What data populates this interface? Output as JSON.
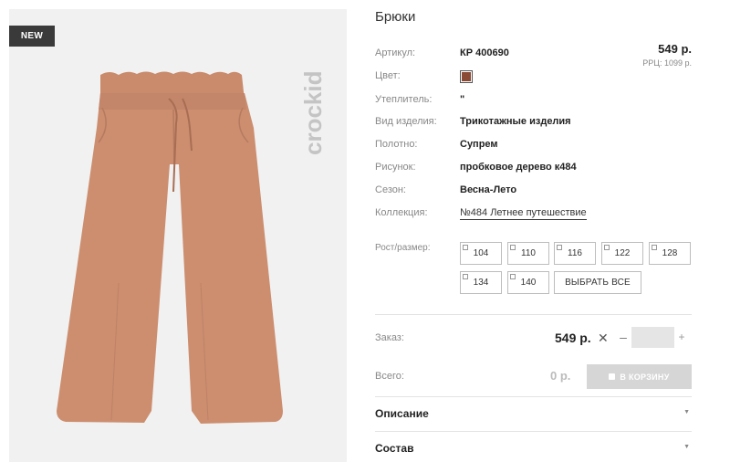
{
  "product": {
    "badge": "NEW",
    "brand_logo": "crockid",
    "title": "Брюки",
    "price": "549 р.",
    "rrc": "РРЦ: 1099 р.",
    "color_swatch": "#8b4a36"
  },
  "attributes": [
    {
      "label": "Артикул:",
      "value": "КР 400690"
    },
    {
      "label": "Цвет:",
      "value": ""
    },
    {
      "label": "Утеплитель:",
      "value": "\""
    },
    {
      "label": "Вид изделия:",
      "value": "Трикотажные изделия"
    },
    {
      "label": "Полотно:",
      "value": "Супрем"
    },
    {
      "label": "Рисунок:",
      "value": "пробковое дерево к484"
    },
    {
      "label": "Сезон:",
      "value": "Весна-Лето"
    },
    {
      "label": "Коллекция:",
      "value": "№484 Летнее путешествие"
    }
  ],
  "sizes": {
    "label": "Рост/размер:",
    "options": [
      "104",
      "110",
      "116",
      "122",
      "128",
      "134",
      "140"
    ],
    "select_all": "ВЫБРАТЬ ВСЕ"
  },
  "order": {
    "label": "Заказ:",
    "price": "549 р.",
    "times": "✕",
    "minus": "–",
    "plus": "+",
    "quantity": ""
  },
  "total": {
    "label": "Всего:",
    "value": "0 р.",
    "cart_button": "В КОРЗИНУ"
  },
  "accordion": {
    "description": "Описание",
    "composition": "Состав",
    "arrow": "▼"
  }
}
